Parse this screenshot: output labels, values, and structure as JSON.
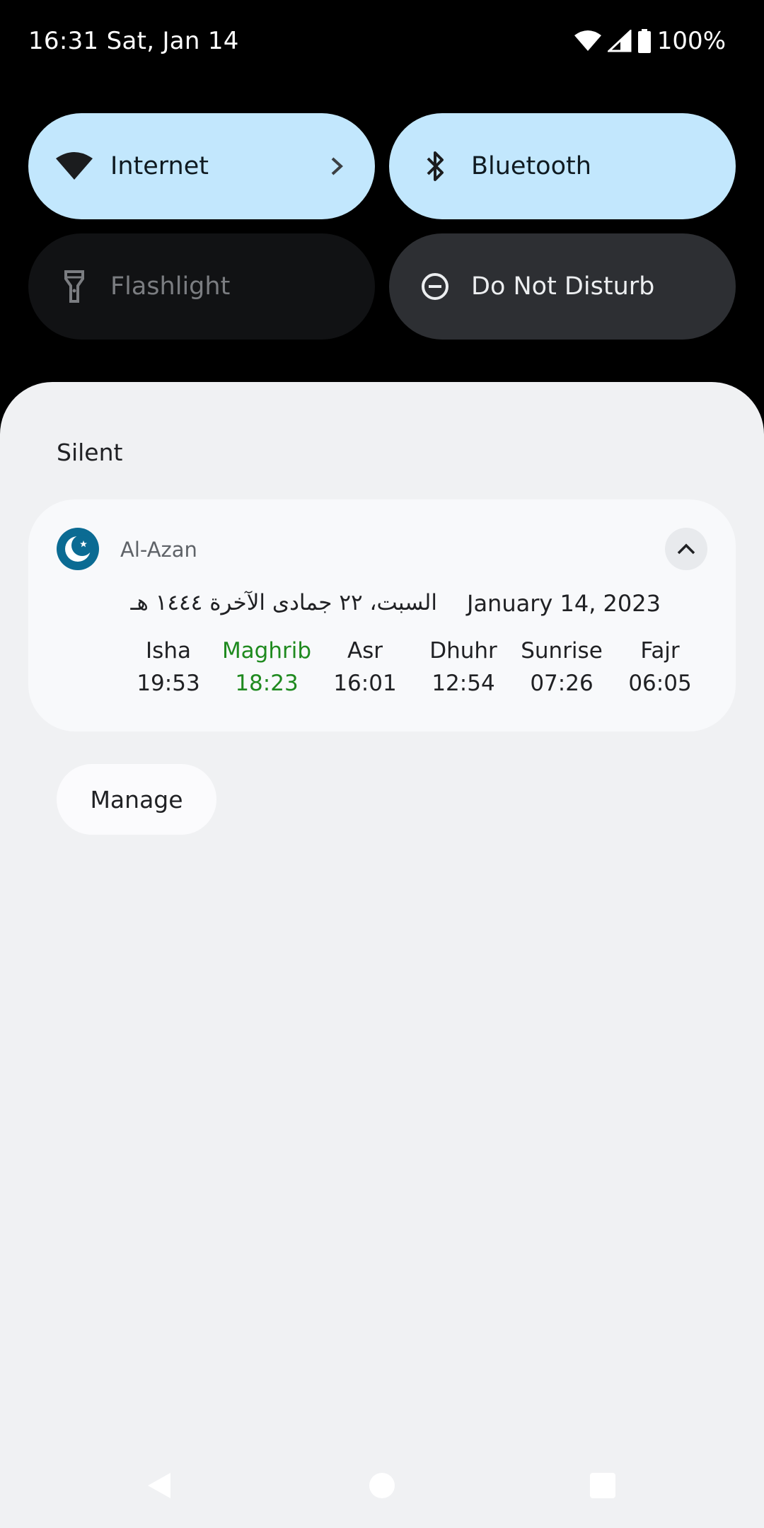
{
  "status_bar": {
    "datetime": "16:31 Sat, Jan 14",
    "battery": "100%",
    "icons": [
      "wifi-icon",
      "signal-icon",
      "battery-icon"
    ]
  },
  "quick_settings": {
    "tiles": [
      {
        "label": "Internet",
        "icon": "wifi-icon",
        "state": "on",
        "has_chevron": true
      },
      {
        "label": "Bluetooth",
        "icon": "bluetooth-icon",
        "state": "on"
      },
      {
        "label": "Flashlight",
        "icon": "flashlight-icon",
        "state": "off"
      },
      {
        "label": "Do Not Disturb",
        "icon": "do-not-disturb-icon",
        "state": "off"
      }
    ]
  },
  "notifications": {
    "section_title": "Silent",
    "card": {
      "app_name": "Al-Azan",
      "app_icon": "crescent-moon-icon",
      "hijri_date": "السبت، ٢٢ جمادى الآخرة ١٤٤٤ هـ",
      "gregorian_date": "January 14, 2023",
      "prayers": [
        {
          "name": "Isha",
          "time": "19:53"
        },
        {
          "name": "Maghrib",
          "time": "18:23",
          "active": true
        },
        {
          "name": "Asr",
          "time": "16:01"
        },
        {
          "name": "Dhuhr",
          "time": "12:54"
        },
        {
          "name": "Sunrise",
          "time": "07:26"
        },
        {
          "name": "Fajr",
          "time": "06:05"
        }
      ]
    },
    "manage_label": "Manage"
  },
  "colors": {
    "tile_on": "#c2e7fd",
    "active_prayer": "#1f8a1f",
    "app_icon_bg": "#0b6b93"
  }
}
